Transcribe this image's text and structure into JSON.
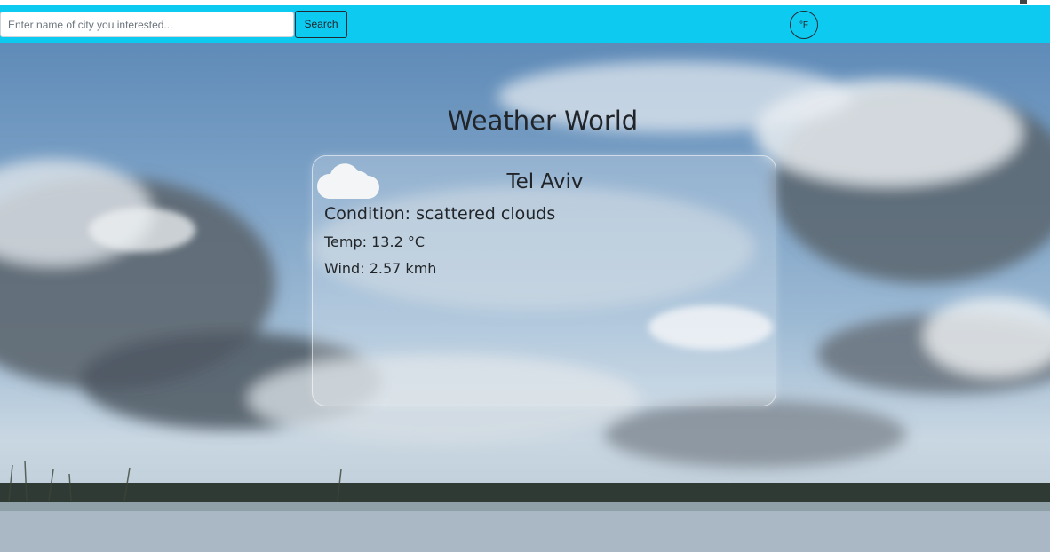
{
  "search": {
    "placeholder": "Enter name of city you interested...",
    "value": "",
    "button_label": "Search"
  },
  "unit_toggle": {
    "label": "°F"
  },
  "main": {
    "title": "Weather World"
  },
  "card": {
    "city": "Tel Aviv",
    "condition_label": "Condition:",
    "condition_value": "scattered clouds",
    "temp_label": "Temp:",
    "temp_value": "13.2",
    "temp_unit": "°C",
    "wind_label": "Wind:",
    "wind_value": "2.57",
    "wind_unit": "kmh",
    "icon": "cloud-icon"
  },
  "colors": {
    "navbar": "#0dcaf0",
    "text": "#212529",
    "sky": "#7ea3c7"
  }
}
